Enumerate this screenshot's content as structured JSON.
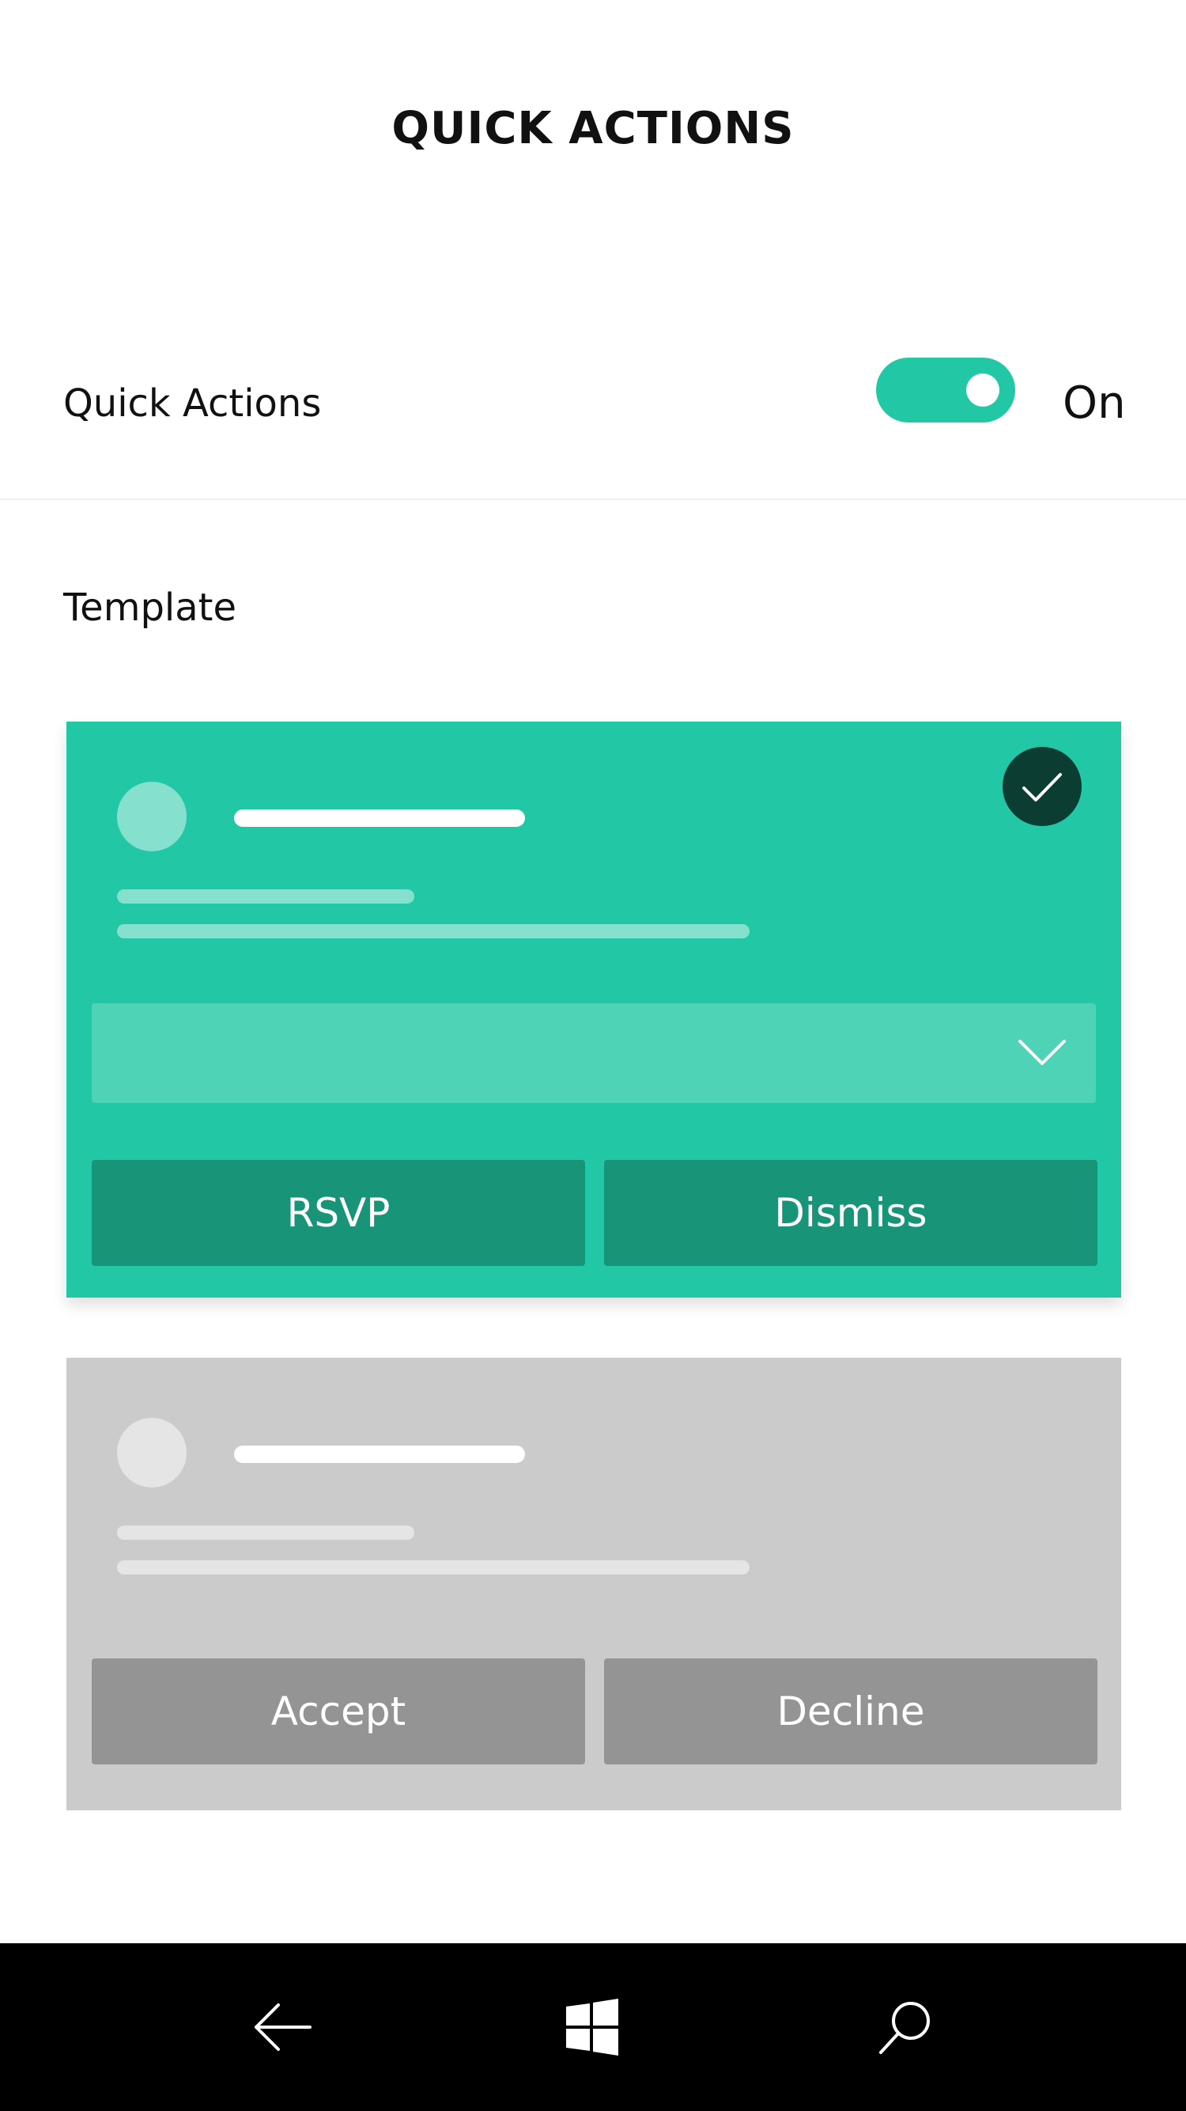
{
  "header": {
    "title": "QUICK ACTIONS"
  },
  "quick_actions": {
    "label": "Quick Actions",
    "state_label": "On",
    "enabled": true
  },
  "template_section": {
    "label": "Template",
    "selected": "rsvp-dismiss",
    "templates": [
      {
        "id": "rsvp-dismiss",
        "buttons": [
          "RSVP",
          "Dismiss"
        ],
        "has_dropdown": true,
        "selected": true
      },
      {
        "id": "accept-decline",
        "buttons": [
          "Accept",
          "Decline"
        ],
        "has_dropdown": false,
        "selected": false
      }
    ]
  },
  "taskbar": {
    "buttons": [
      "back-icon",
      "windows-logo-icon",
      "search-icon"
    ]
  },
  "colors": {
    "accent": "#22c8a5",
    "accent_dark": "#189478",
    "check_badge": "#0c3d33",
    "inactive_card": "#cbcbcb",
    "inactive_button": "#949494",
    "taskbar": "#000000"
  }
}
